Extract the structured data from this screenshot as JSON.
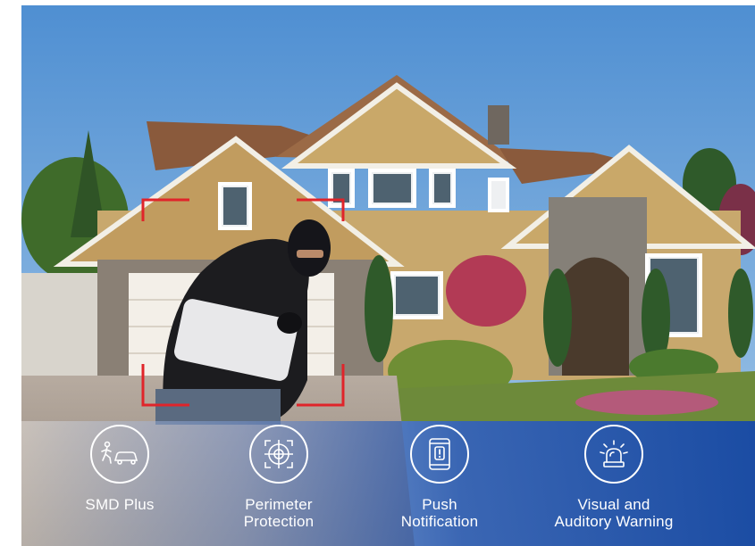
{
  "features": [
    {
      "icon": "person-car-icon",
      "label": "SMD Plus"
    },
    {
      "icon": "crosshair-icon",
      "label": "Perimeter\nProtection"
    },
    {
      "icon": "phone-alert-icon",
      "label": "Push\nNotification"
    },
    {
      "icon": "siren-icon",
      "label": "Visual and\nAuditory Warning"
    }
  ],
  "colors": {
    "detection_frame": "#e0242a",
    "bar_blue": "#1f4fa0",
    "sky": "#6aa3d8"
  }
}
